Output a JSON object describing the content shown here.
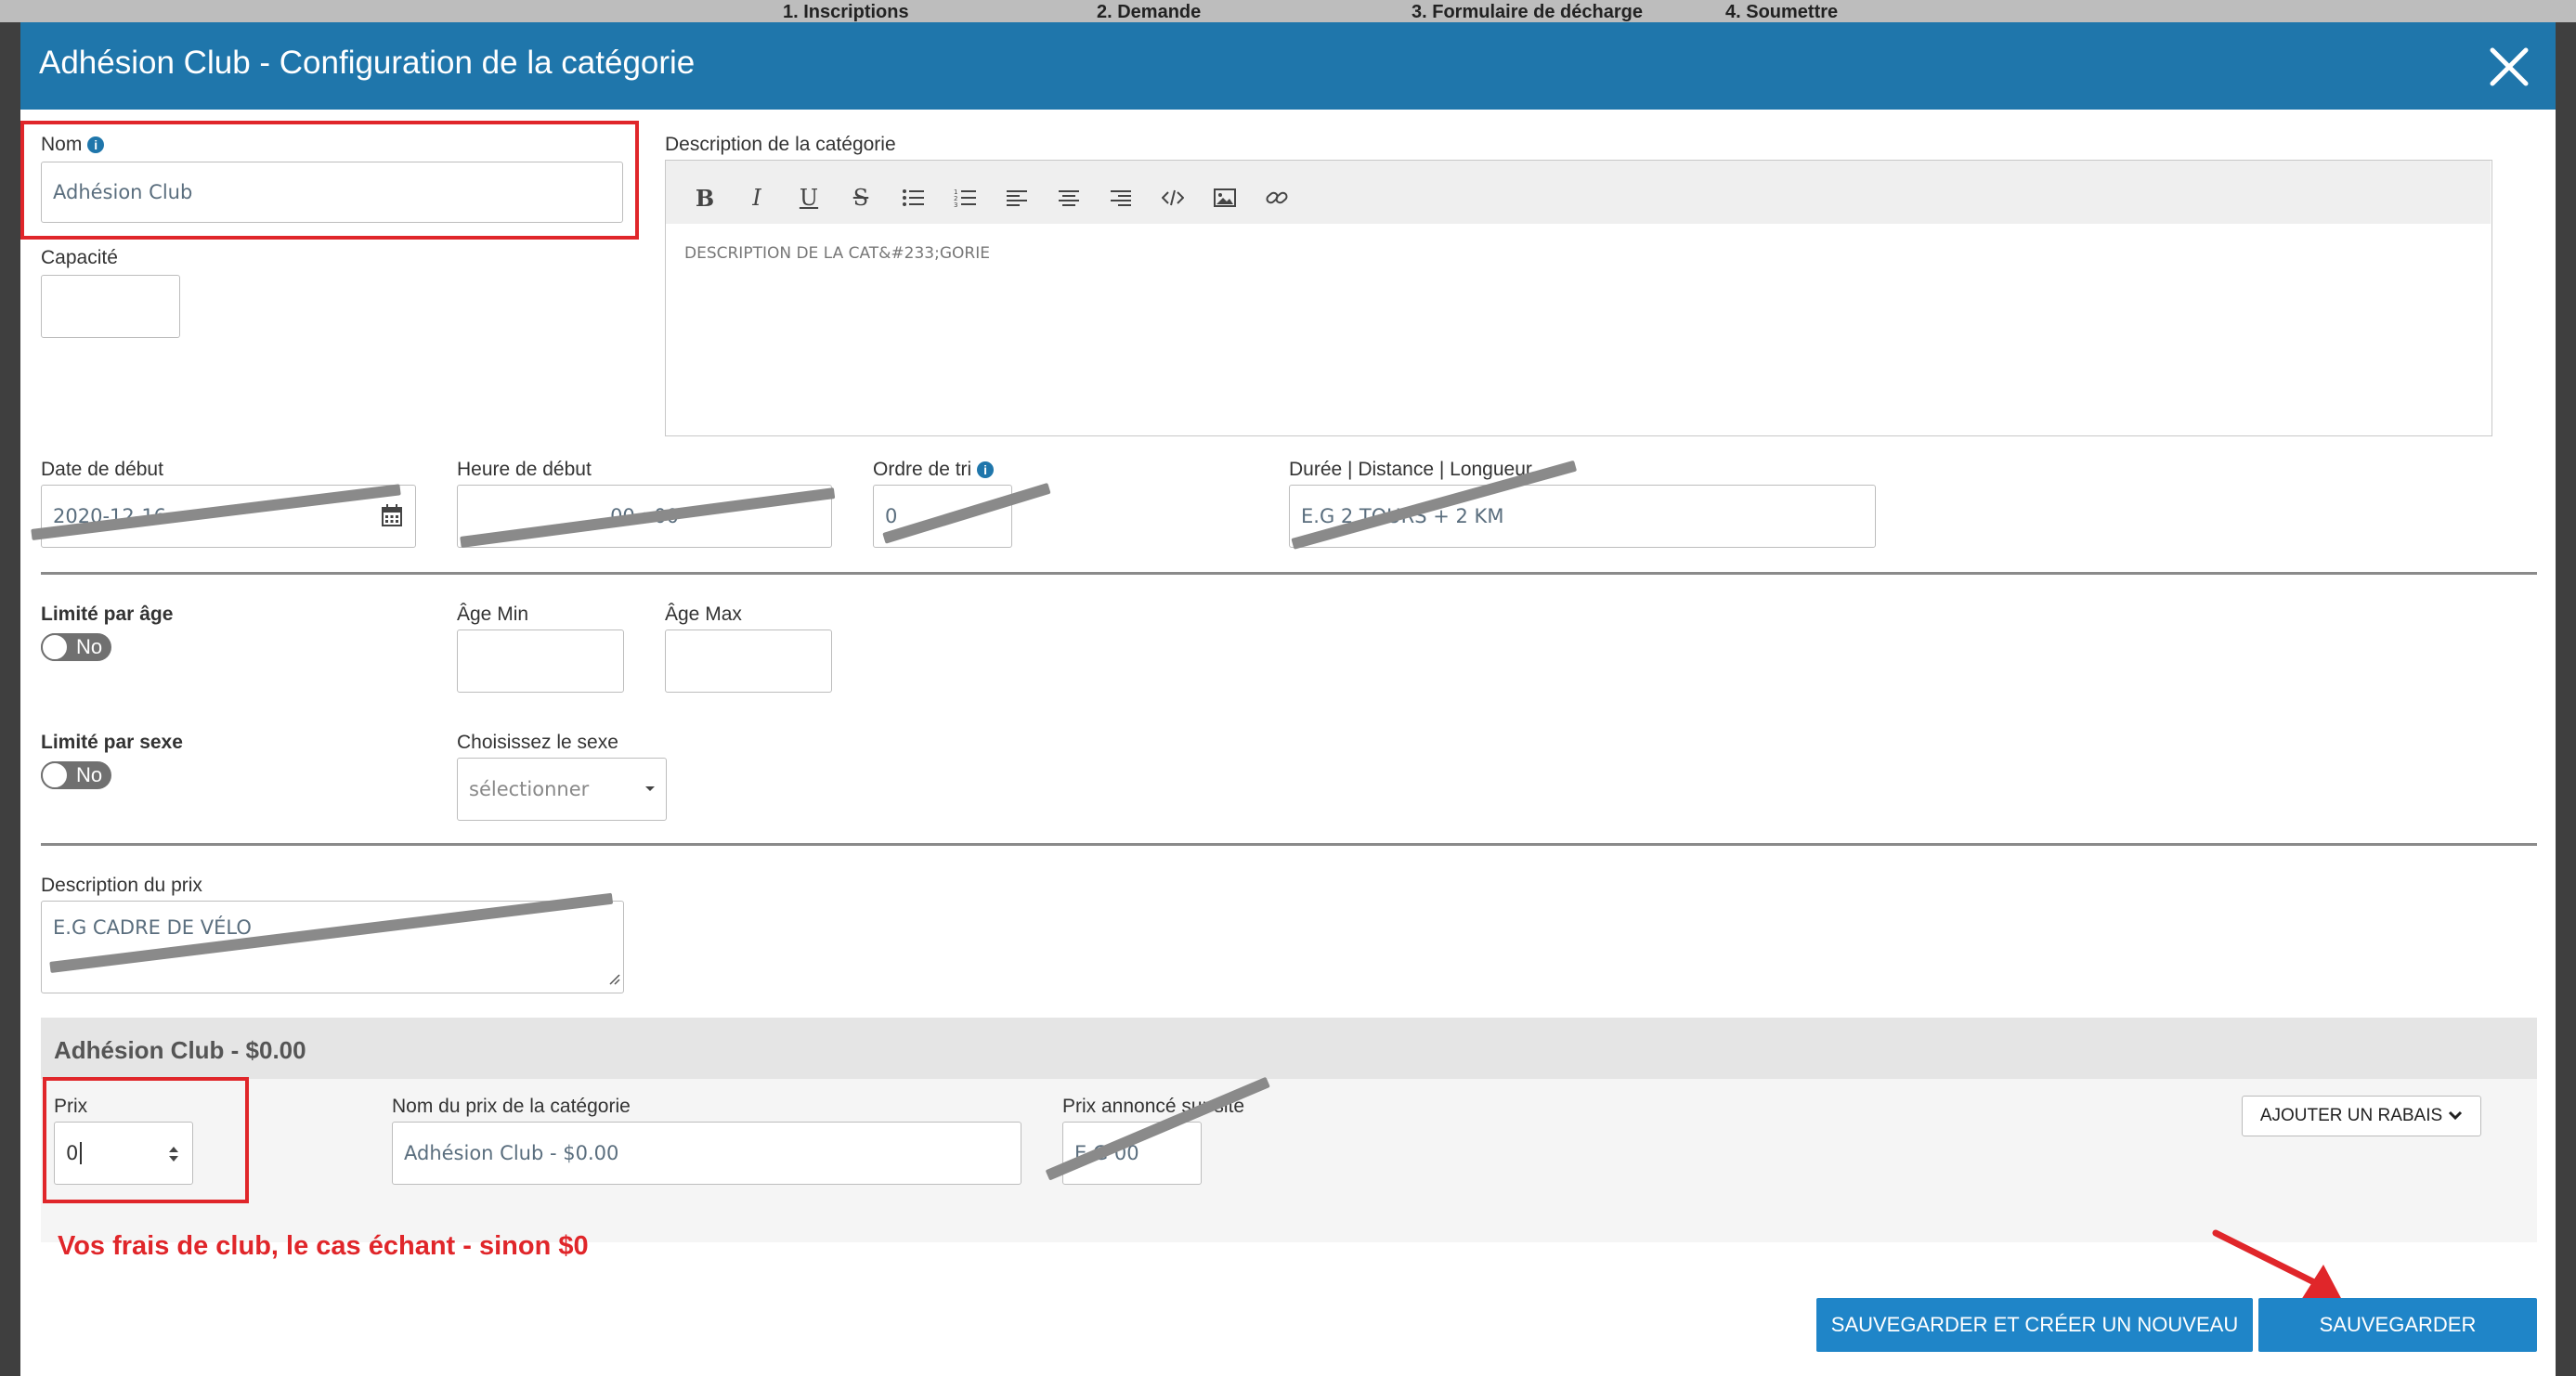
{
  "background_steps": [
    "1. Inscriptions",
    "2. Demande",
    "3. Formulaire de décharge",
    "4. Soumettre"
  ],
  "modal": {
    "title": "Adhésion Club - Configuration de la catégorie",
    "close_icon": "close-icon"
  },
  "form": {
    "name": {
      "label": "Nom",
      "value": "Adhésion Club"
    },
    "capacity": {
      "label": "Capacité",
      "value": ""
    },
    "description": {
      "label": "Description de la catégorie",
      "content": "DESCRIPTION DE LA CAT&#233;GORIE",
      "toolbar": [
        "bold-icon",
        "italic-icon",
        "underline-icon",
        "strikethrough-icon",
        "bullet-list-icon",
        "numbered-list-icon",
        "align-left-icon",
        "align-center-icon",
        "align-right-icon",
        "code-icon",
        "image-icon",
        "link-icon"
      ]
    },
    "start_date": {
      "label": "Date de début",
      "value": "2020-12-16"
    },
    "start_time": {
      "label": "Heure de début",
      "value": "00 : 00"
    },
    "sort_order": {
      "label": "Ordre de tri",
      "value": "0"
    },
    "duration": {
      "label": "Durée | Distance | Longueur",
      "placeholder": "E.G 2 TOURS + 2 KM"
    },
    "age_limit": {
      "label": "Limité par âge",
      "toggle": "No"
    },
    "age_min": {
      "label": "Âge Min",
      "value": ""
    },
    "age_max": {
      "label": "Âge Max",
      "value": ""
    },
    "sex_limit": {
      "label": "Limité par sexe",
      "toggle": "No"
    },
    "sex_select": {
      "label": "Choisissez le sexe",
      "selected": "sélectionner"
    },
    "price_description": {
      "label": "Description du prix",
      "placeholder": "E.G CADRE DE VÉLO"
    }
  },
  "price_section": {
    "header": "Adhésion Club - $0.00",
    "price": {
      "label": "Prix",
      "value": "0"
    },
    "price_name": {
      "label": "Nom du prix de la catégorie",
      "value": "Adhésion Club - $0.00"
    },
    "advertised": {
      "label": "Prix annoncé sur site",
      "placeholder": "E.G 00"
    },
    "discount_button": "AJOUTER UN RABAIS"
  },
  "annotation": "Vos frais de club, le cas échant - sinon $0",
  "buttons": {
    "save_and_new": "SAUVEGARDER ET CRÉER UN NOUVEAU",
    "save": "SAUVEGARDER"
  },
  "colors": {
    "header_blue": "#1f76ab",
    "button_blue": "#1f85c8",
    "annotation_red": "#e0262a",
    "strike_gray": "#8a8a8a"
  }
}
